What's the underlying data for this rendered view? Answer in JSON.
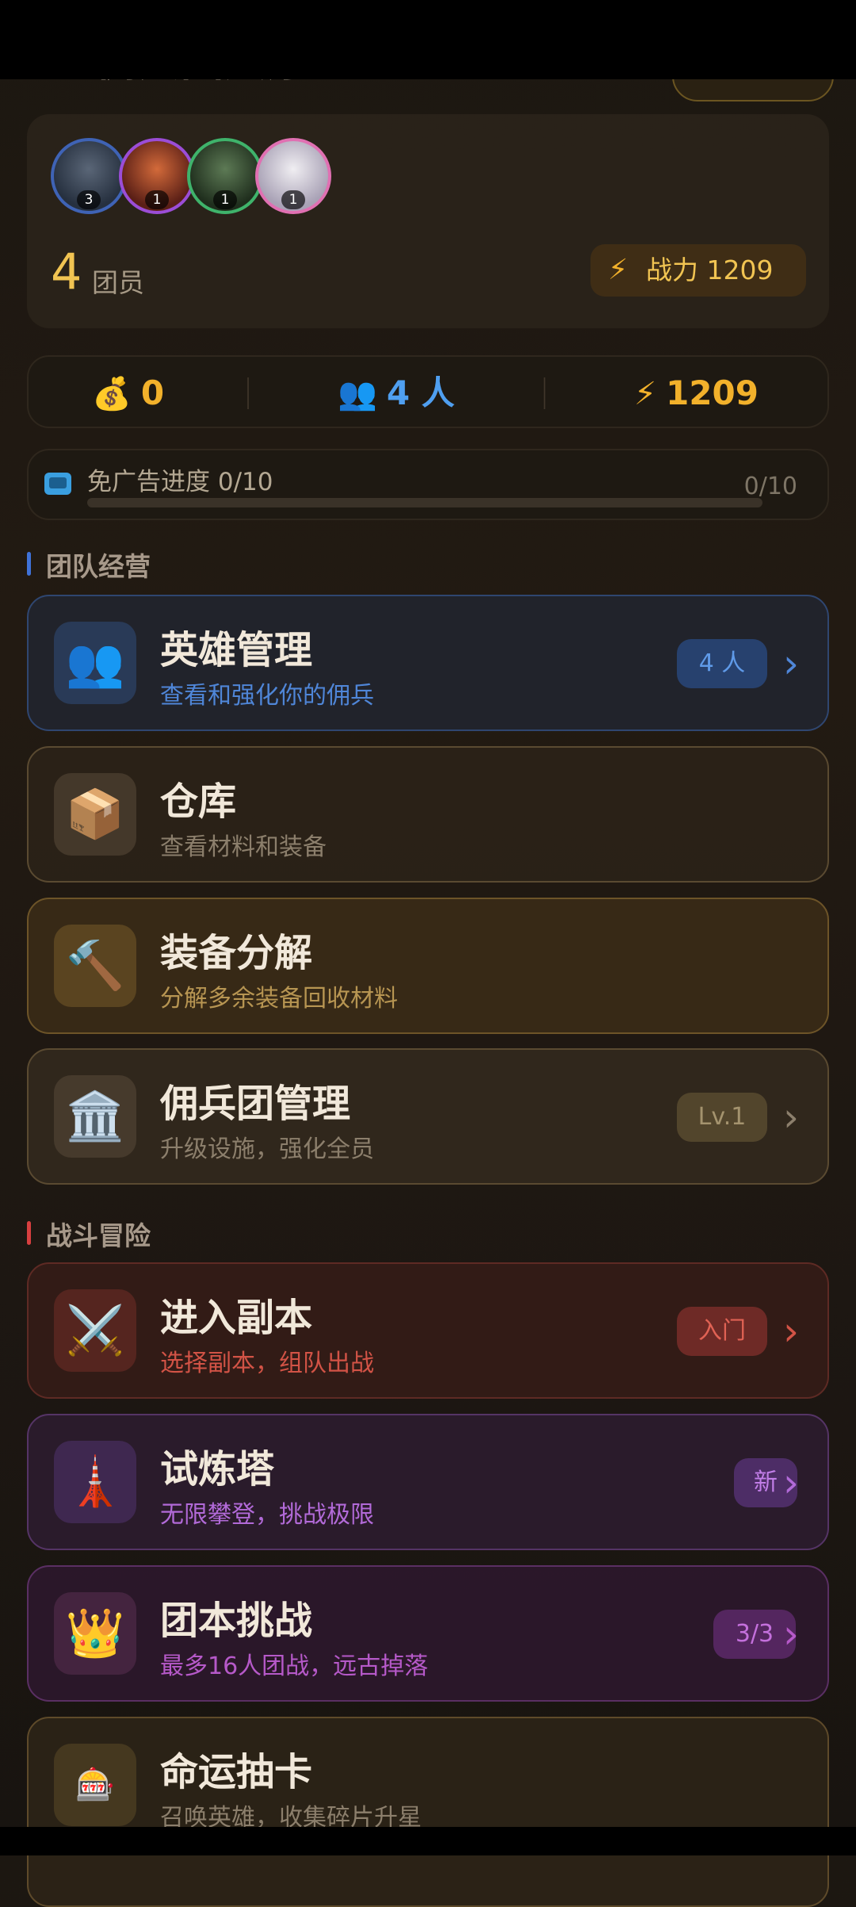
{
  "header": {
    "title_partial": "佣兵团大厅"
  },
  "team": {
    "avatars": [
      {
        "name": "warrior",
        "level": "3"
      },
      {
        "name": "fire-mage",
        "level": "1"
      },
      {
        "name": "ranger",
        "level": "1"
      },
      {
        "name": "priestess",
        "level": "1"
      }
    ],
    "member_count": "4",
    "member_label": "团员",
    "power_label": "战力 1209"
  },
  "stats": {
    "gold": {
      "icon": "money-bag-icon",
      "value": "0"
    },
    "members": {
      "icon": "people-icon",
      "value": "4 人"
    },
    "power": {
      "icon": "lightning-icon",
      "value": "1209"
    }
  },
  "ad_progress": {
    "label": "免广告进度 0/10",
    "count": "0/10",
    "fraction": 0.0
  },
  "sections": {
    "team_ops": "团队经营",
    "battle": "战斗冒险"
  },
  "menu": [
    {
      "icon": "👥",
      "title": "英雄管理",
      "subtitle": "查看和强化你的佣兵",
      "badge": "4 人"
    },
    {
      "icon": "📦",
      "title": "仓库",
      "subtitle": "查看材料和装备"
    },
    {
      "icon": "🔨",
      "title": "装备分解",
      "subtitle": "分解多余装备回收材料"
    },
    {
      "icon": "🏛️",
      "title": "佣兵团管理",
      "subtitle": "升级设施，强化全员",
      "badge": "Lv.1"
    },
    {
      "icon": "⚔️",
      "title": "进入副本",
      "subtitle": "选择副本，组队出战",
      "badge": "入门"
    },
    {
      "icon": "🗼",
      "title": "试炼塔",
      "subtitle": "无限攀登，挑战极限",
      "badge": "新"
    },
    {
      "icon": "👑",
      "title": "团本挑战",
      "subtitle": "最多16人团战，远古掉落",
      "badge": "3/3"
    },
    {
      "icon": "🎰",
      "title": "命运抽卡",
      "subtitle": "召唤英雄，收集碎片升星"
    }
  ],
  "colors": {
    "gold_accent": "#f2b12b",
    "blue_accent": "#4f86d8",
    "red_accent": "#d25346",
    "purple_accent": "#b26ad8"
  }
}
